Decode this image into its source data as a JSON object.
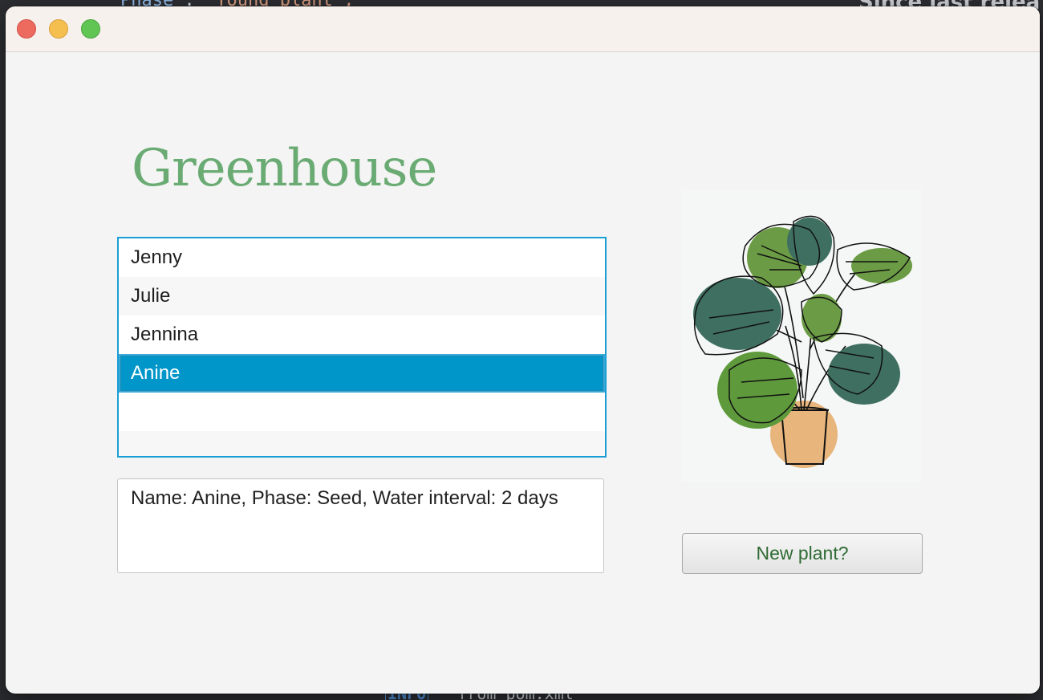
{
  "background": {
    "code_line_key": "Phase",
    "code_line_sep": " : ",
    "code_line_value": "\"Young plant\",",
    "heading": "Since last relea",
    "log_tag": "INFO",
    "log_text": "from pom.xml"
  },
  "window": {
    "controls": [
      "close-button",
      "minimize-button",
      "maximize-button"
    ],
    "title_color": "#6aab73",
    "selection_color": "#0096c9"
  },
  "app": {
    "title": "Greenhouse",
    "plants": [
      {
        "label": "Jenny"
      },
      {
        "label": "Julie"
      },
      {
        "label": "Jennina"
      },
      {
        "label": "Anine"
      },
      {
        "label": ""
      },
      {
        "label": ""
      }
    ],
    "selected_index": 3,
    "details": "Name: Anine, Phase: Seed, Water interval: 2 days",
    "new_plant_label": "New plant?",
    "illustration_icon": "monstera-plant-icon"
  }
}
